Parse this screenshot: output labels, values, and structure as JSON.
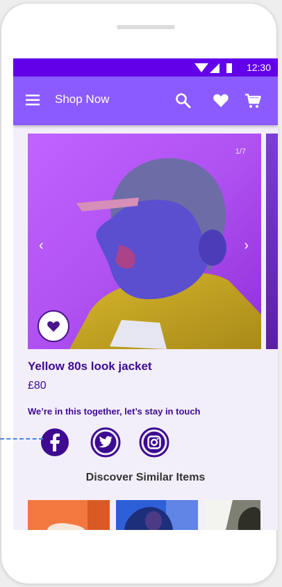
{
  "status_bar": {
    "time": "12:30"
  },
  "app_bar": {
    "title": "Shop Now",
    "actions": [
      "search-icon",
      "heart-icon",
      "cart-icon"
    ]
  },
  "gallery": {
    "counter": "1/7",
    "prev_glyph": "‹",
    "next_glyph": "›"
  },
  "product": {
    "name": "Yellow 80s look jacket",
    "price": "£80"
  },
  "social": {
    "heading": "We’re in this together, let’s stay in touch",
    "networks": [
      "facebook-icon",
      "twitter-icon",
      "instagram-icon"
    ]
  },
  "similar": {
    "heading": "Discover Similar Items"
  },
  "colors": {
    "status_bar": "#6200ea",
    "app_bar": "#8c5bff",
    "primary_dark": "#3d0a91",
    "screen_bg": "#f3effa"
  }
}
